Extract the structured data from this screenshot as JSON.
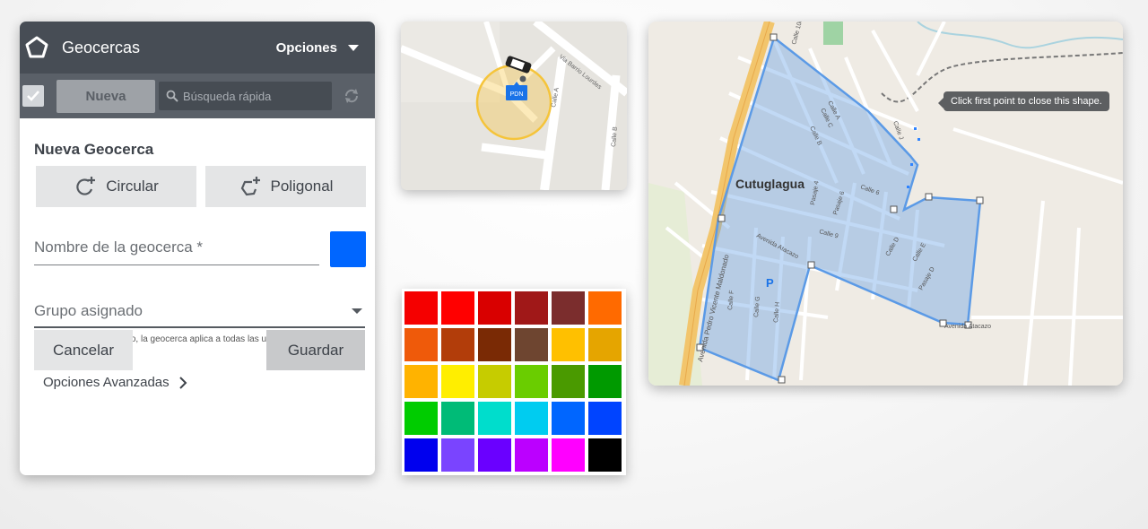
{
  "panel": {
    "title": "Geocercas",
    "options_label": "Opciones",
    "toolbar": {
      "new_label": "Nueva",
      "search_placeholder": "Búsqueda rápida"
    },
    "form": {
      "title": "Nueva Geocerca",
      "circular_label": "Circular",
      "polygon_label": "Poligonal",
      "name_placeholder": "Nombre de la geocerca *",
      "selected_color": "#0066ff",
      "group_placeholder": "Grupo asignado",
      "group_hint": "Si no hay grupo asignado, la geocerca aplica a todas las unidades",
      "advanced_label": "Opciones Avanzadas",
      "cancel_label": "Cancelar",
      "save_label": "Guardar"
    }
  },
  "circle_map": {
    "marker_label": "PDN",
    "streets": [
      "Via Barrio Lourdes",
      "Calle A",
      "Calle B"
    ],
    "geofence_color": "#f5c43a"
  },
  "palette": {
    "colors": [
      "#f50000",
      "#ff0000",
      "#d90000",
      "#a01818",
      "#7b2d2d",
      "#ff6a00",
      "#ef5a0a",
      "#b23d0a",
      "#7a2a05",
      "#6e4530",
      "#ffc000",
      "#e5a500",
      "#ffb300",
      "#ffee00",
      "#c6cc00",
      "#6acd00",
      "#4a9a00",
      "#009a00",
      "#00cc00",
      "#00bb77",
      "#00ddcc",
      "#00ccf0",
      "#0066ff",
      "#0044ff",
      "#0000ee",
      "#7a44ff",
      "#6a00ff",
      "#bb00ff",
      "#ff00ff",
      "#000000"
    ]
  },
  "polygon_map": {
    "tooltip": "Click first point to close this shape.",
    "town_label": "Cutuglagua",
    "main_road": "Avenida Pedro Vicente Maldonado",
    "streets": [
      "Calle 100",
      "Calle 6",
      "Calle 9",
      "Avenida Atacazo",
      "Pasaje 4",
      "Pasaje 6",
      "Pasaje D",
      "Calle A",
      "Calle B",
      "Calle C",
      "Calle D",
      "Calle E",
      "Calle F",
      "Calle G",
      "Calle H",
      "Calle J",
      "Avenida Atacazo"
    ],
    "parking_label": "P",
    "polygon_color": "#5b9ae6"
  }
}
